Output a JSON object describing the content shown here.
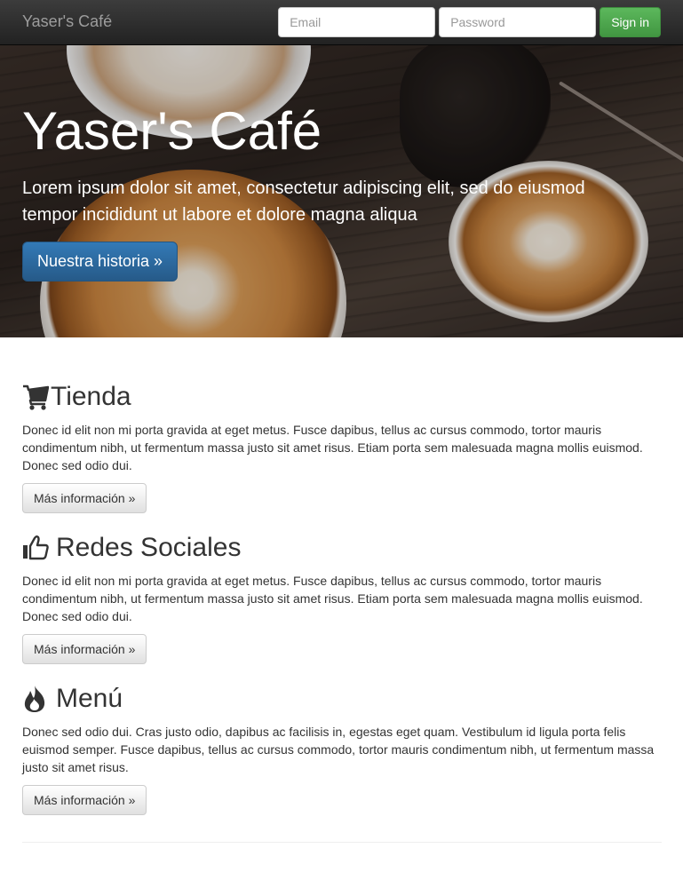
{
  "navbar": {
    "brand": "Yaser's Café",
    "email_placeholder": "Email",
    "password_placeholder": "Password",
    "signin_label": "Sign in"
  },
  "jumbotron": {
    "title": "Yaser's Café",
    "text": "Lorem ipsum dolor sit amet, consectetur adipiscing elit, sed do eiusmod tempor incididunt ut labore et dolore magna aliqua",
    "button_label": "Nuestra historia »"
  },
  "sections": [
    {
      "icon": "shopping-cart-icon",
      "title": "Tienda",
      "text": "Donec id elit non mi porta gravida at eget metus. Fusce dapibus, tellus ac cursus commodo, tortor mauris condimentum nibh, ut fermentum massa justo sit amet risus. Etiam porta sem malesuada magna mollis euismod. Donec sed odio dui.",
      "button_label": "Más información »"
    },
    {
      "icon": "thumbs-up-icon",
      "title": "Redes Sociales",
      "text": "Donec id elit non mi porta gravida at eget metus. Fusce dapibus, tellus ac cursus commodo, tortor mauris condimentum nibh, ut fermentum massa justo sit amet risus. Etiam porta sem malesuada magna mollis euismod. Donec sed odio dui.",
      "button_label": "Más información »"
    },
    {
      "icon": "fire-icon",
      "title": "Menú",
      "text": "Donec sed odio dui. Cras justo odio, dapibus ac facilisis in, egestas eget quam. Vestibulum id ligula porta felis euismod semper. Fusce dapibus, tellus ac cursus commodo, tortor mauris condimentum nibh, ut fermentum massa justo sit amet risus.",
      "button_label": "Más información »"
    }
  ],
  "colors": {
    "navbar_bg": "#222222",
    "success": "#5cb85c",
    "primary": "#337ab7",
    "text": "#333333"
  }
}
